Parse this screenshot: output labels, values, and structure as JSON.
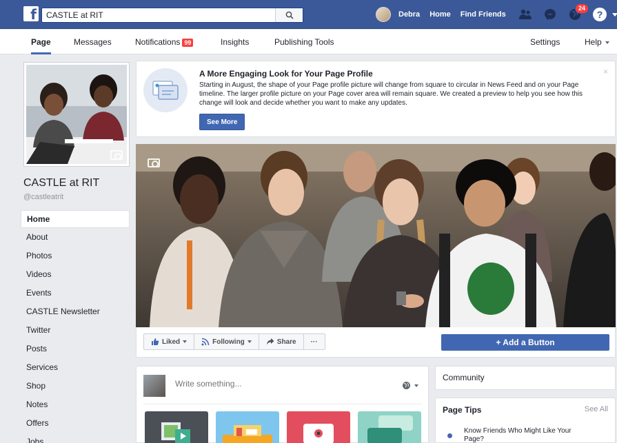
{
  "topbar": {
    "search_value": "CASTLE at RIT",
    "user_name": "Debra",
    "home_label": "Home",
    "find_friends_label": "Find Friends",
    "notifications_count": "24",
    "help_label": "?"
  },
  "page_nav": {
    "page": "Page",
    "messages": "Messages",
    "notifications": "Notifications",
    "notifications_badge": "99",
    "insights": "Insights",
    "publishing_tools": "Publishing Tools",
    "settings": "Settings",
    "help": "Help"
  },
  "profile": {
    "name": "CASTLE at RIT",
    "handle": "@castleatrit"
  },
  "sidebar": {
    "items": [
      {
        "label": "Home"
      },
      {
        "label": "About"
      },
      {
        "label": "Photos"
      },
      {
        "label": "Videos"
      },
      {
        "label": "Events"
      },
      {
        "label": "CASTLE Newsletter"
      },
      {
        "label": "Twitter"
      },
      {
        "label": "Posts"
      },
      {
        "label": "Services"
      },
      {
        "label": "Shop"
      },
      {
        "label": "Notes"
      },
      {
        "label": "Offers"
      },
      {
        "label": "Jobs"
      }
    ]
  },
  "announcement": {
    "title": "A More Engaging Look for Your Page Profile",
    "body": "Starting in August, the shape of your Page profile picture will change from square to circular in News Feed and on your Page timeline. The larger profile picture on your Page cover area will remain square. We created a preview to help you see how this change will look and decide whether you want to make any updates.",
    "button": "See More",
    "close": "×"
  },
  "actions": {
    "liked": "Liked",
    "following": "Following",
    "share": "Share",
    "more": "···",
    "add_button": "+ Add a Button"
  },
  "composer": {
    "placeholder": "Write something..."
  },
  "community": {
    "title": "Community"
  },
  "page_tips": {
    "title": "Page Tips",
    "see_all": "See All",
    "tip": "Know Friends Who Might Like Your Page?"
  },
  "colors": {
    "brand_blue": "#3b5998",
    "button_blue": "#4267b2",
    "badge_red": "#fa3e3e"
  }
}
